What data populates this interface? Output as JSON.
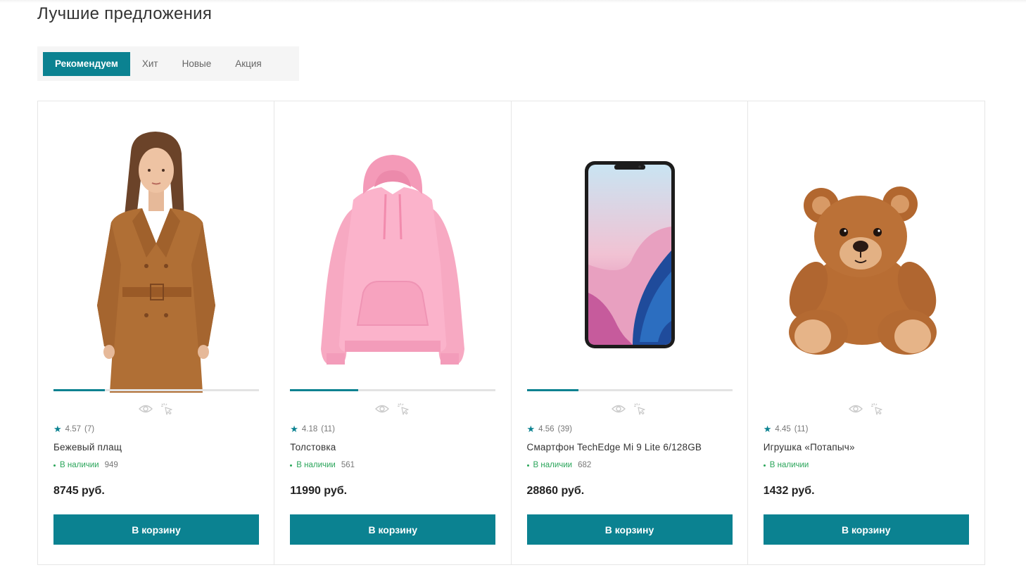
{
  "section": {
    "title": "Лучшие предложения"
  },
  "tabs": [
    {
      "label": "Рекомендуем",
      "active": true
    },
    {
      "label": "Хит",
      "active": false
    },
    {
      "label": "Новые",
      "active": false
    },
    {
      "label": "Акция",
      "active": false
    }
  ],
  "colors": {
    "accent": "#0b8291",
    "in_stock": "#2aa55a",
    "border": "#e6e6e6"
  },
  "products": [
    {
      "name": "Бежевый плащ",
      "rating": "4.57",
      "reviews": "(7)",
      "stock": "В наличии",
      "qty": "949",
      "price": "8745 руб.",
      "button": "В корзину",
      "image": "trench-coat-woman",
      "gallery_progress": 0.25
    },
    {
      "name": "Толстовка",
      "rating": "4.18",
      "reviews": "(11)",
      "stock": "В наличии",
      "qty": "561",
      "price": "11990 руб.",
      "button": "В корзину",
      "image": "pink-hoodie",
      "gallery_progress": 0.33
    },
    {
      "name": "Смартфон TechEdge Mi 9 Lite 6/128GB",
      "rating": "4.56",
      "reviews": "(39)",
      "stock": "В наличии",
      "qty": "682",
      "price": "28860 руб.",
      "button": "В корзину",
      "image": "smartphone",
      "gallery_progress": 0.25
    },
    {
      "name": "Игрушка «Потапыч»",
      "rating": "4.45",
      "reviews": "(11)",
      "stock": "В наличии",
      "qty": "",
      "price": "1432 руб.",
      "button": "В корзину",
      "image": "teddy-bear",
      "gallery_progress": 0
    }
  ],
  "icons": {
    "quick_view": "eye-icon",
    "compare": "pointer-click-icon",
    "rating": "star-icon"
  }
}
